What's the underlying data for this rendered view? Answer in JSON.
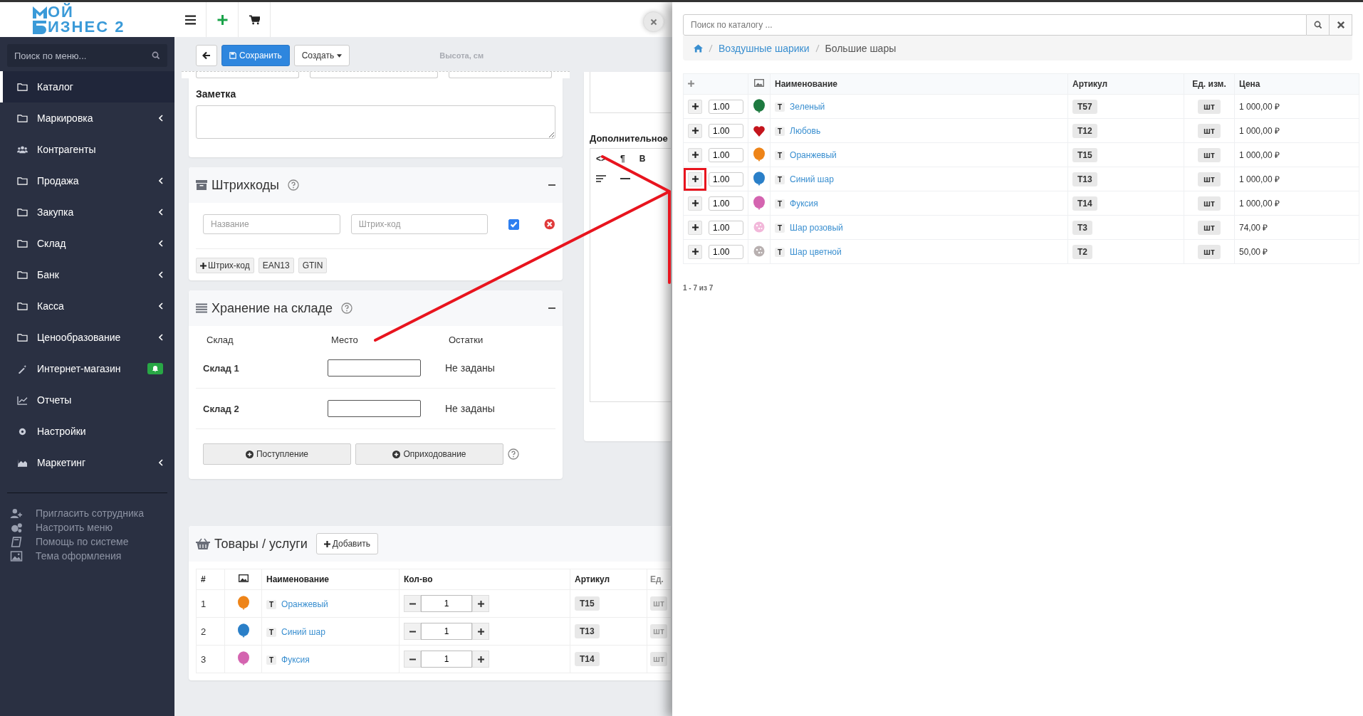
{
  "logo": {
    "top": "ОЙ",
    "bottom": "ИЗНЕС 2"
  },
  "topbar": {
    "tools": [
      {
        "kind": "menu"
      },
      {
        "kind": "add"
      },
      {
        "kind": "cart"
      }
    ]
  },
  "sidebar": {
    "search": {
      "placeholder": "Поиск по меню..."
    },
    "items": [
      {
        "label": "Каталог",
        "kind": "folder",
        "expandable": false,
        "selected": true,
        "alert": false
      },
      {
        "label": "Маркировка",
        "kind": "folder",
        "expandable": true,
        "selected": false,
        "alert": false
      },
      {
        "label": "Контрагенты",
        "kind": "users",
        "expandable": false,
        "selected": false,
        "alert": false
      },
      {
        "label": "Продажа",
        "kind": "folder",
        "expandable": true,
        "selected": false,
        "alert": false
      },
      {
        "label": "Закупка",
        "kind": "folder",
        "expandable": true,
        "selected": false,
        "alert": false
      },
      {
        "label": "Склад",
        "kind": "folder",
        "expandable": true,
        "selected": false,
        "alert": false
      },
      {
        "label": "Банк",
        "kind": "folder",
        "expandable": true,
        "selected": false,
        "alert": false
      },
      {
        "label": "Касса",
        "kind": "folder",
        "expandable": true,
        "selected": false,
        "alert": false
      },
      {
        "label": "Ценообразование",
        "kind": "folder",
        "expandable": true,
        "selected": false,
        "alert": false
      },
      {
        "label": "Интернет-магазин",
        "kind": "wand",
        "expandable": false,
        "selected": false,
        "alert": true
      },
      {
        "label": "Отчеты",
        "kind": "chart",
        "expandable": false,
        "selected": false,
        "alert": false
      },
      {
        "label": "Настройки",
        "kind": "gear",
        "expandable": false,
        "selected": false,
        "alert": false
      },
      {
        "label": "Маркетинг",
        "kind": "area",
        "expandable": true,
        "selected": false,
        "alert": false
      }
    ],
    "links": [
      {
        "label": "Пригласить сотрудника",
        "kind": "user-plus"
      },
      {
        "label": "Настроить меню",
        "kind": "gears"
      },
      {
        "label": "Помощь по системе",
        "kind": "book"
      },
      {
        "label": "Тема оформления",
        "kind": "image"
      }
    ]
  },
  "toolbar": {
    "save": "Сохранить",
    "create": "Создать",
    "faded_label": "Высота, см"
  },
  "note": {
    "label": "Заметка"
  },
  "barcodes": {
    "title": "Штрихкоды",
    "name_placeholder": "Название",
    "code_placeholder": "Штрих-код",
    "checked": true,
    "buttons": [
      {
        "label": "Штрих-код",
        "kind": "add"
      },
      {
        "label": "EAN13",
        "kind": "plain"
      },
      {
        "label": "GTIN",
        "kind": "plain"
      }
    ]
  },
  "storage": {
    "title": "Хранение на складе",
    "columns": [
      "Склад",
      "Место",
      "Остатки"
    ],
    "rows": [
      {
        "name": "Склад 1",
        "stock": "Не заданы"
      },
      {
        "name": "Склад 2",
        "stock": "Не заданы"
      }
    ],
    "buttons": [
      "Поступление",
      "Оприходование"
    ]
  },
  "editor": {
    "title": "Дополнительное",
    "tools": [
      "<>",
      "¶",
      "B"
    ]
  },
  "products": {
    "title": "Товары / услуги",
    "add": "Добавить",
    "columns": [
      "#",
      "Наименование",
      "Кол-во",
      "Артикул",
      "Ед."
    ],
    "rows": [
      {
        "index": "1",
        "color": "#ee8418",
        "type": "Т",
        "name": "Оранжевый",
        "qty": "1",
        "sku": "T15",
        "unit": "шт"
      },
      {
        "index": "2",
        "color": "#2a7fc8",
        "type": "Т",
        "name": "Синий шар",
        "qty": "1",
        "sku": "T13",
        "unit": "шт"
      },
      {
        "index": "3",
        "color": "#d464b0",
        "type": "Т",
        "name": "Фуксия",
        "qty": "1",
        "sku": "T14",
        "unit": "шт"
      }
    ]
  },
  "catalog": {
    "search": {
      "placeholder": "Поиск по каталогу ..."
    },
    "breadcrumb": [
      "Воздушные шарики",
      "Большие шары"
    ],
    "columns": [
      "Наименование",
      "Артикул",
      "Ед. изм.",
      "Цена"
    ],
    "rows": [
      {
        "qty": "1.00",
        "kind": "balloon",
        "color": "#1e7a40",
        "type": "Т",
        "name": "Зеленый",
        "sku": "T57",
        "unit": "шт",
        "price": "1 000,00 ₽",
        "highlighted": false
      },
      {
        "qty": "1.00",
        "kind": "heart",
        "color": "#c4141c",
        "type": "Т",
        "name": "Любовь",
        "sku": "T12",
        "unit": "шт",
        "price": "1 000,00 ₽",
        "highlighted": false
      },
      {
        "qty": "1.00",
        "kind": "balloon",
        "color": "#ee8418",
        "type": "Т",
        "name": "Оранжевый",
        "sku": "T15",
        "unit": "шт",
        "price": "1 000,00 ₽",
        "highlighted": false
      },
      {
        "qty": "1.00",
        "kind": "balloon",
        "color": "#2a7fc8",
        "type": "Т",
        "name": "Синий шар",
        "sku": "T13",
        "unit": "шт",
        "price": "1 000,00 ₽",
        "highlighted": true
      },
      {
        "qty": "1.00",
        "kind": "balloon",
        "color": "#d464b0",
        "type": "Т",
        "name": "Фуксия",
        "sku": "T14",
        "unit": "шт",
        "price": "1 000,00 ₽",
        "highlighted": false
      },
      {
        "qty": "1.00",
        "kind": "pattern",
        "color": "#f2b8da",
        "type": "Т",
        "name": "Шар розовый",
        "sku": "T3",
        "unit": "шт",
        "price": "74,00 ₽",
        "highlighted": false
      },
      {
        "qty": "1.00",
        "kind": "pattern",
        "color": "#b8b0b0",
        "type": "Т",
        "name": "Шар цветной",
        "sku": "T2",
        "unit": "шт",
        "price": "50,00 ₽",
        "highlighted": false
      }
    ],
    "pager": "1 - 7 из 7"
  }
}
